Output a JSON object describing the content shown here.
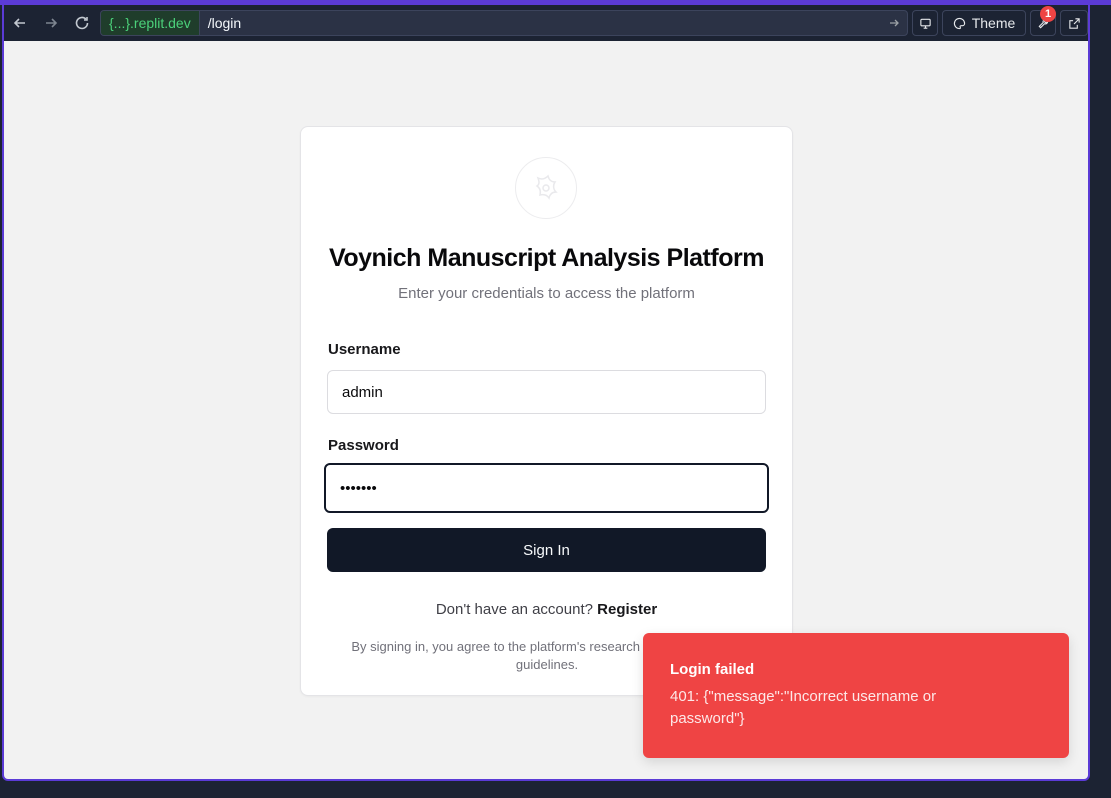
{
  "browser": {
    "host": "{...}.replit.dev",
    "path": "/login",
    "theme_label": "Theme",
    "devtools_badge": "1"
  },
  "login": {
    "title": "Voynich Manuscript Analysis Platform",
    "subtitle": "Enter your credentials to access the platform",
    "username_label": "Username",
    "username_value": "admin",
    "password_label": "Password",
    "password_value": "•••••••",
    "submit_label": "Sign In",
    "register_prompt": "Don't have an account?",
    "register_link": "Register",
    "terms_text": "By signing in, you agree to the platform's research and collaboration guidelines."
  },
  "toast": {
    "title": "Login failed",
    "description": "401: {\"message\":\"Incorrect username or password\"}"
  },
  "colors": {
    "accent": "#5b3bd6",
    "primary_button": "#111827",
    "error_toast": "#ef4444"
  }
}
